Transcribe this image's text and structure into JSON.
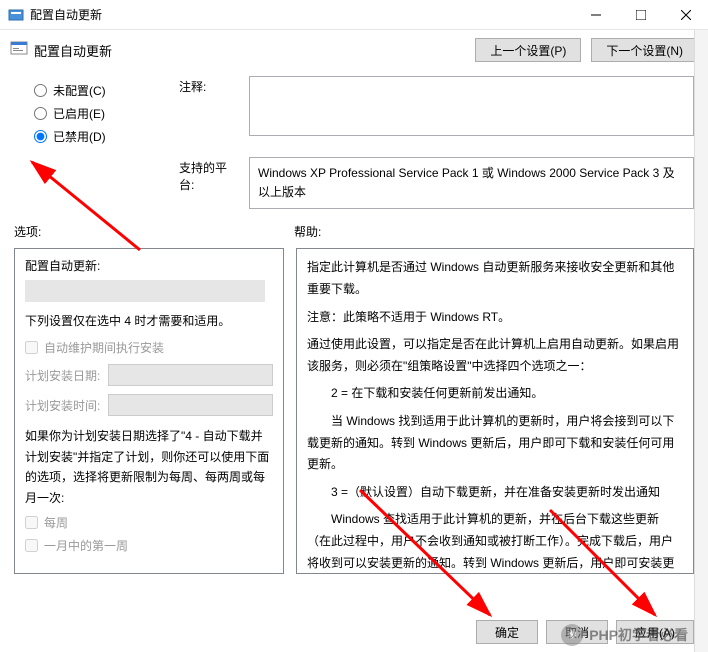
{
  "titlebar": {
    "title": "配置自动更新"
  },
  "subheader": {
    "title": "配置自动更新",
    "prev": "上一个设置(P)",
    "next": "下一个设置(N)"
  },
  "radios": {
    "r1": "未配置(C)",
    "r2": "已启用(E)",
    "r3": "已禁用(D)"
  },
  "labels": {
    "comment": "注释:",
    "platform": "支持的平台:",
    "options": "选项:",
    "help": "帮助:"
  },
  "platform_text": "Windows XP Professional Service Pack 1 或 Windows 2000 Service Pack 3 及以上版本",
  "left": {
    "hdr": "配置自动更新:",
    "note": "下列设置仅在选中 4 时才需要和适用。",
    "chk_auto": "自动维护期间执行安装",
    "date_label": "计划安装日期:",
    "time_label": "计划安装时间:",
    "wrap": "如果你为计划安装日期选择了\"4 - 自动下载并计划安装\"并指定了计划，则你还可以使用下面的选项，选择将更新限制为每周、每两周或每月一次:",
    "chk_weekly": "每周",
    "chk_first": "一月中的第一周"
  },
  "help": {
    "p1": "指定此计算机是否通过 Windows 自动更新服务来接收安全更新和其他重要下载。",
    "p2": "注意：此策略不适用于 Windows RT。",
    "p3": "通过使用此设置，可以指定是否在此计算机上启用自动更新。如果启用该服务，则必须在\"组策略设置\"中选择四个选项之一：",
    "p4": "2 = 在下载和安装任何更新前发出通知。",
    "p5": "当 Windows 找到适用于此计算机的更新时，用户将会接到可以下载更新的通知。转到 Windows 更新后，用户即可下载和安装任何可用更新。",
    "p6": "3 =（默认设置）自动下载更新，并在准备安装更新时发出通知",
    "p7": "Windows 查找适用于此计算机的更新，并在后台下载这些更新（在此过程中，用户不会收到通知或被打断工作）。完成下载后，用户将收到可以安装更新的通知。转到 Windows 更新后，用户即可安装更新。"
  },
  "footer": {
    "ok": "确定",
    "cancel": "取消",
    "apply": "应用(A)"
  },
  "watermark": "PHP初学者必看"
}
